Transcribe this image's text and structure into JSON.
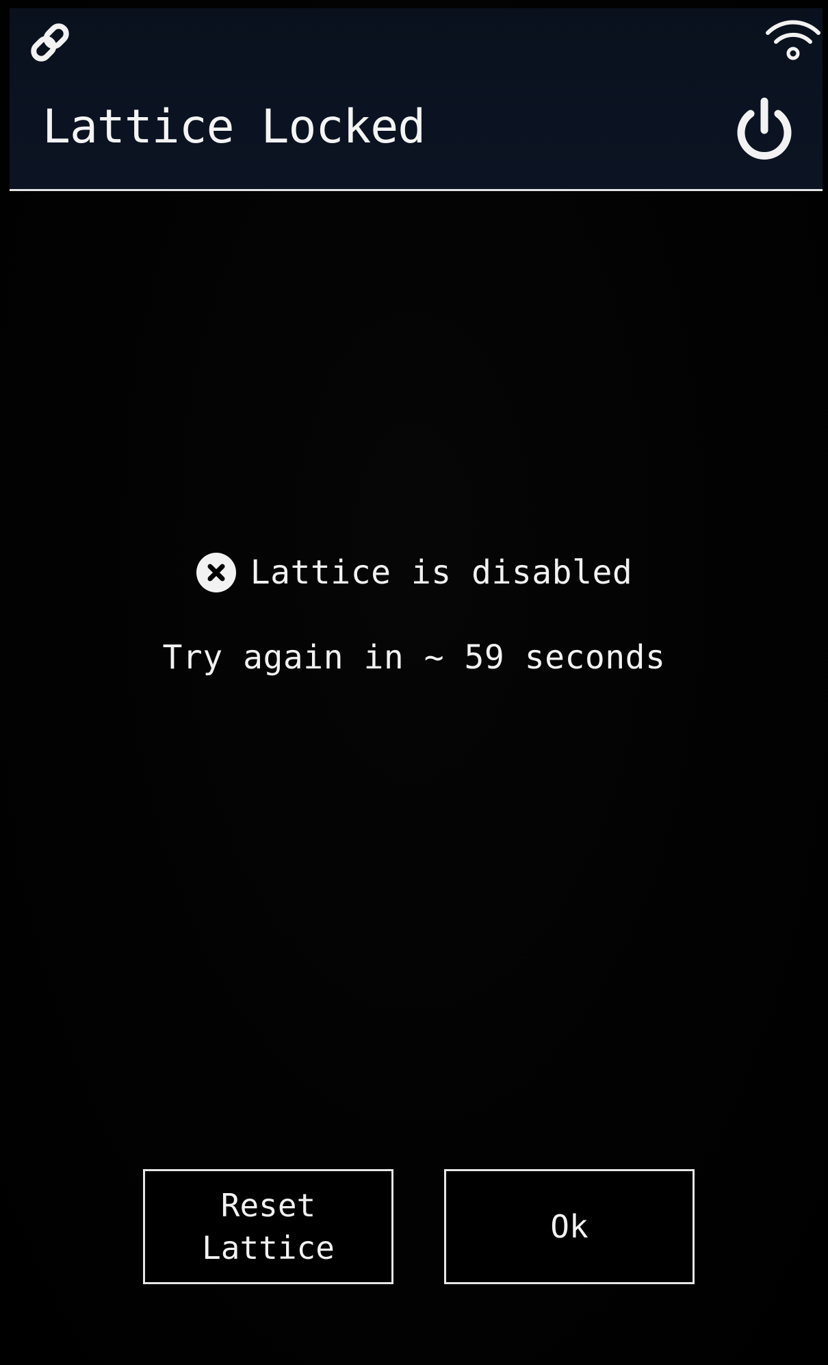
{
  "header": {
    "title": "Lattice Locked",
    "left_icon": "link-icon",
    "right_status_icon": "wifi-icon",
    "action_icon": "power-icon"
  },
  "message": {
    "status_icon": "error-x-circle-icon",
    "status": "Lattice is disabled",
    "retry": "Try again in ~ 59 seconds"
  },
  "buttons": {
    "reset_line1": "Reset",
    "reset_line2": "Lattice",
    "ok": "Ok"
  },
  "colors": {
    "background": "#000000",
    "header_background": "#0b1322",
    "foreground": "#f2f2f2",
    "border": "#e6e6e6"
  }
}
